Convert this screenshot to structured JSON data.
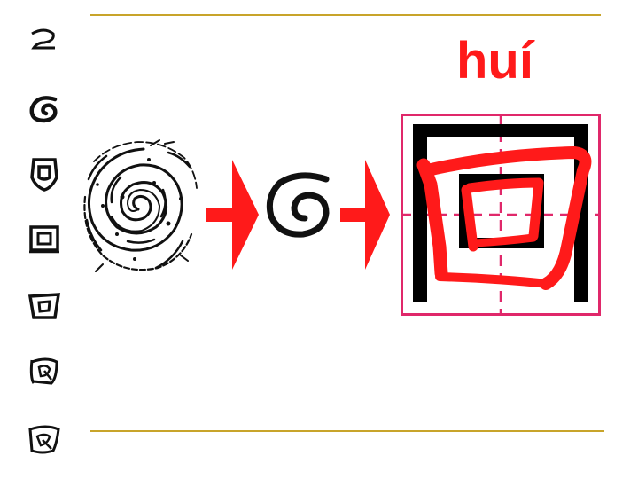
{
  "pinyin": "huí",
  "colors": {
    "rule": "#c8a42a",
    "arrow": "#ff1a1a",
    "frame": "#e0286a",
    "character": "#ff1a1a",
    "pinyin": "#ff1a1a"
  },
  "evolution_glyphs": [
    {
      "name": "glyph-oracle-1"
    },
    {
      "name": "glyph-oracle-2"
    },
    {
      "name": "glyph-bronze"
    },
    {
      "name": "glyph-seal"
    },
    {
      "name": "glyph-clerical"
    },
    {
      "name": "glyph-cursive-1"
    },
    {
      "name": "glyph-cursive-2"
    }
  ],
  "icons": [
    "whirlpool-image",
    "arrow-right-icon",
    "spiral-glyph",
    "arrow-right-icon",
    "character-hui"
  ]
}
